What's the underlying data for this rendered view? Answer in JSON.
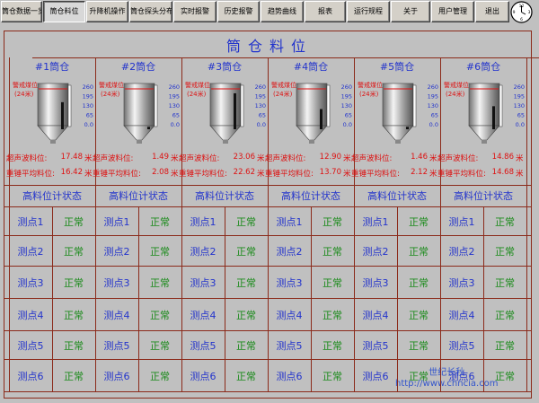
{
  "nav": [
    {
      "label": "筒仓数据一览"
    },
    {
      "label": "筒仓料位"
    },
    {
      "label": "升降机操作"
    },
    {
      "label": "筒仓探头分布"
    },
    {
      "label": "实时报警"
    },
    {
      "label": "历史报警"
    },
    {
      "label": "趋势曲线"
    },
    {
      "label": "报表"
    },
    {
      "label": "运行规程"
    },
    {
      "label": "关于"
    },
    {
      "label": "用户管理"
    },
    {
      "label": "退出"
    }
  ],
  "clock_numbers": [
    "12",
    "3",
    "6",
    "9"
  ],
  "page_title": "筒仓料位",
  "labels": {
    "warn": "警戒煤位",
    "warn_m": "(24米)",
    "ultra": "超声波料位:",
    "hammer": "重锤平均料位:",
    "unit": "米",
    "status_header": "高料位计状态"
  },
  "scale": [
    "260",
    "195",
    "130",
    "65",
    "0.0"
  ],
  "silos": [
    {
      "name": "#1筒仓",
      "ultrasonic": "17.48",
      "hammer": "16.42",
      "fill": 0.67
    },
    {
      "name": "#2筒仓",
      "ultrasonic": "1.49",
      "hammer": "2.08",
      "fill": 0.06
    },
    {
      "name": "#3筒仓",
      "ultrasonic": "23.06",
      "hammer": "22.62",
      "fill": 0.89
    },
    {
      "name": "#4筒仓",
      "ultrasonic": "12.90",
      "hammer": "13.70",
      "fill": 0.5
    },
    {
      "name": "#5筒仓",
      "ultrasonic": "1.46",
      "hammer": "2.12",
      "fill": 0.06
    },
    {
      "name": "#6筒仓",
      "ultrasonic": "14.86",
      "hammer": "14.68",
      "fill": 0.57
    }
  ],
  "points": [
    {
      "label": "测点1",
      "status": "正常"
    },
    {
      "label": "测点2",
      "status": "正常"
    },
    {
      "label": "测点3",
      "status": "正常"
    },
    {
      "label": "测点4",
      "status": "正常"
    },
    {
      "label": "测点5",
      "status": "正常"
    },
    {
      "label": "测点6",
      "status": "正常"
    }
  ],
  "watermark": {
    "line1": "世纪长秋",
    "line2": "http://www.chncia.com"
  },
  "colors": {
    "frame": "#8b2a1a",
    "title": "#2233cc",
    "reading": "#dd1111",
    "status": "#1a8a1a",
    "level": "#111111"
  }
}
